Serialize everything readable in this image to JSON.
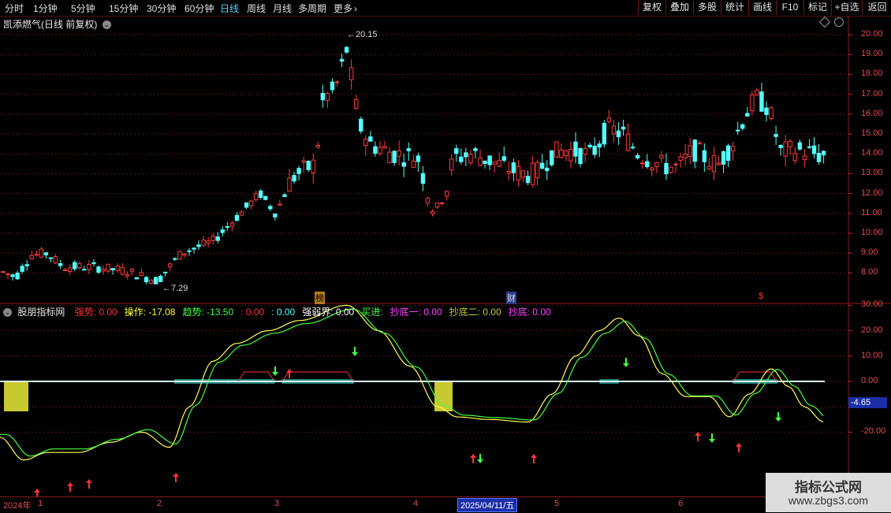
{
  "toolbar": {
    "periods": [
      "分时",
      "1分钟",
      "5分钟",
      "15分钟",
      "30分钟",
      "60分钟",
      "日线",
      "周线",
      "月线",
      "多周期",
      "更多"
    ],
    "active_period": "日线",
    "more_icon": "chevron-right-icon",
    "right_buttons": [
      "复权",
      "叠加",
      "多股",
      "统计",
      "画线",
      "F10",
      "标记",
      "+自选",
      "返回"
    ]
  },
  "main_panel": {
    "title": "凯添燃气(日线 前复权)",
    "dropdown_icon": "chevron-down-circle-icon",
    "corner_icons": [
      "diamond-icon",
      "circle-icon"
    ],
    "high_label": "20.15",
    "low_label": "7.29",
    "y_ticks": [
      "20.00",
      "19.00",
      "18.00",
      "17.00",
      "16.00",
      "15.00",
      "14.00",
      "13.00",
      "12.00",
      "11.00",
      "10.00",
      "9.00",
      "8.00"
    ],
    "markers": {
      "bang": "榜",
      "cai": "财",
      "dollar": "$"
    },
    "colors": {
      "up": "#ff3b3b",
      "down": "#54ffff"
    }
  },
  "indicator_panel": {
    "name": "股朋指标网",
    "items": [
      {
        "label": "强势:",
        "value": "0.00",
        "color": "#ff3333"
      },
      {
        "label": "操作:",
        "value": "-17.08",
        "color": "#ffff44"
      },
      {
        "label": "趋势:",
        "value": "-13.50",
        "color": "#44ff44"
      },
      {
        "label": ":",
        "value": "0.00",
        "color": "#ff3333"
      },
      {
        "label": ":",
        "value": "0.00",
        "color": "#54ffff"
      },
      {
        "label": "强弱界:",
        "value": "0.00",
        "color": "#ffffff"
      },
      {
        "label": "买进:",
        "value": "",
        "color": "#44ff44"
      },
      {
        "label": "抄底一:",
        "value": "0.00",
        "color": "#ff44ff"
      },
      {
        "label": "抄底二:",
        "value": "0.00",
        "color": "#c8c830"
      },
      {
        "label": "抄底:",
        "value": "0.00",
        "color": "#ff44ff"
      }
    ],
    "y_ticks": [
      "30.00",
      "20.00",
      "10.00",
      "0.00",
      "-10.00",
      "-20.00"
    ],
    "current_value": "-4.65"
  },
  "date_axis": {
    "labels": [
      "2024年",
      "1",
      "2",
      "3",
      "4",
      "5",
      "6"
    ],
    "highlight": "2025/04/11/五"
  },
  "watermark": {
    "line1": "指标公式网",
    "line2": "www.zbgs3.com"
  }
}
